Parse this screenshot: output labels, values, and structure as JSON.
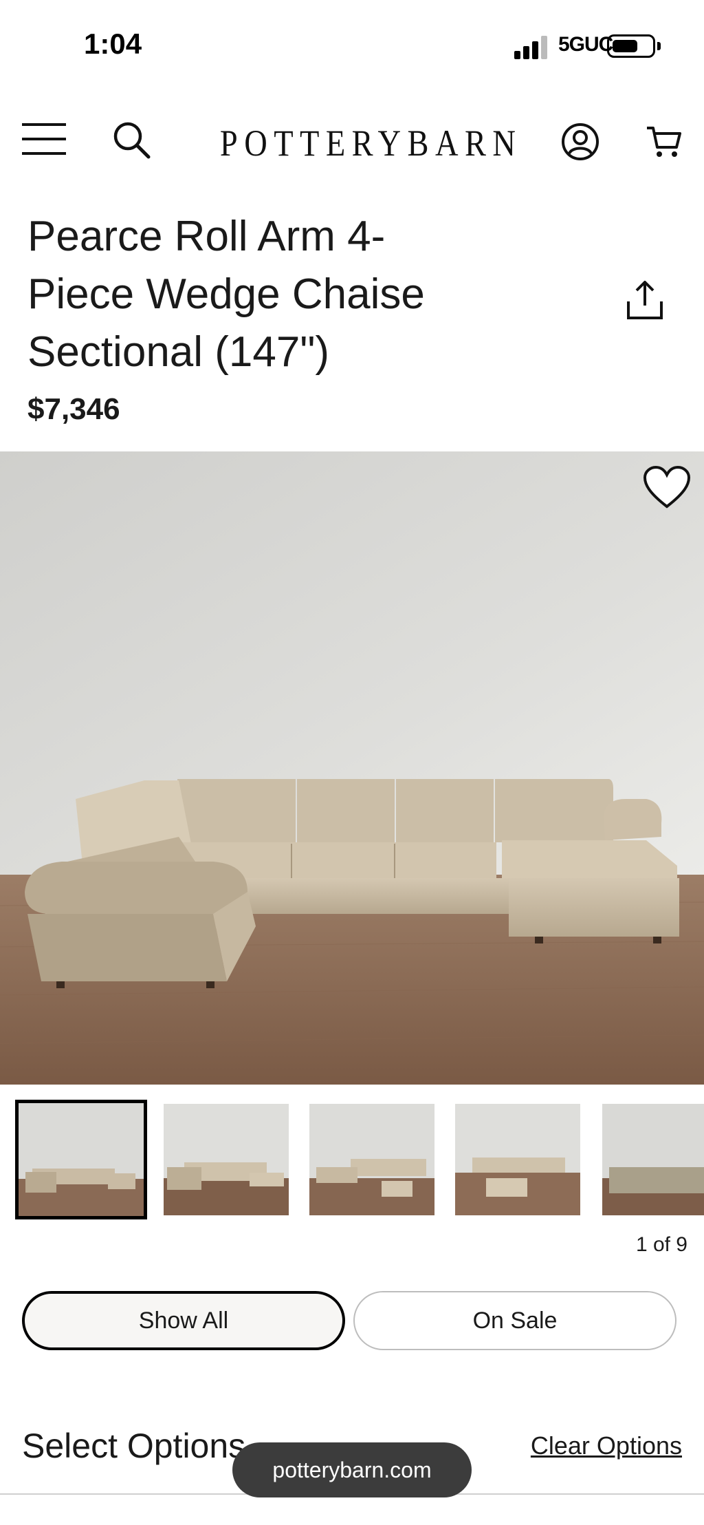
{
  "status_bar": {
    "time": "1:04",
    "network": "5GUC",
    "battery_level": 0.65
  },
  "header": {
    "brand": "POTTERYBARN",
    "icons": [
      "menu-icon",
      "search-icon",
      "account-icon",
      "cart-icon"
    ]
  },
  "product": {
    "title": "Pearce Roll Arm 4-Piece Wedge Chaise Sectional (147\")",
    "price": "$7,346",
    "share_icon": "share-icon",
    "wishlist_icon": "heart-icon"
  },
  "gallery": {
    "counter": "1 of 9",
    "thumbnails_visible": 5,
    "selected_index": 0
  },
  "filters": {
    "show_all_label": "Show All",
    "on_sale_label": "On Sale",
    "active": "Show All"
  },
  "options": {
    "title": "Select Options",
    "clear_label": "Clear Options"
  },
  "browser": {
    "url": "potterybarn.com"
  },
  "colors": {
    "text": "#1a1a1a",
    "wall": "#d9d9d6",
    "floor": "#8a6a55",
    "sofa": "#c9bba4",
    "url_pill": "#3c3c3c"
  }
}
